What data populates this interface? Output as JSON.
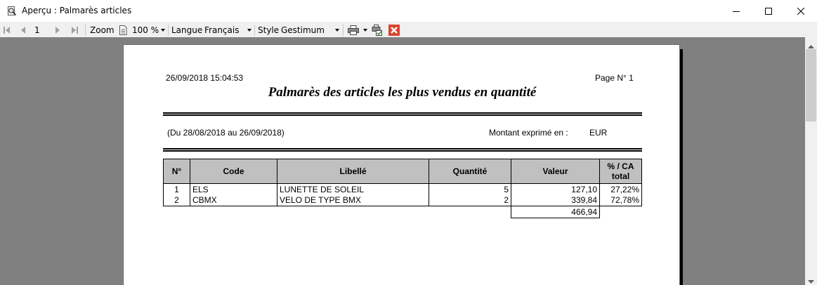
{
  "window": {
    "title": "Aperçu : Palmarès articles"
  },
  "toolbar": {
    "page_value": "1",
    "zoom_label": "Zoom",
    "zoom_value": "100 %",
    "langue_label": "Langue",
    "langue_value": "Français",
    "style_label": "Style",
    "style_value": "Gestimum"
  },
  "report": {
    "datetime": "26/09/2018 15:04:53",
    "page_number": "Page N° 1",
    "title": "Palmarès des articles les plus vendus en quantité",
    "period": "(Du 28/08/2018 au 26/09/2018)",
    "amount_label": "Montant exprimé en :",
    "currency": "EUR",
    "columns": {
      "no": "N°",
      "code": "Code",
      "libelle": "Libellé",
      "quantite": "Quantité",
      "valeur": "Valeur",
      "pct_line1": "% / CA",
      "pct_line2": "total"
    },
    "rows": [
      {
        "no": "1",
        "code": "ELS",
        "libelle": "LUNETTE DE SOLEIL",
        "quantite": "5",
        "valeur": "127,10",
        "pct": "27,22%"
      },
      {
        "no": "2",
        "code": "CBMX",
        "libelle": "VELO DE TYPE BMX",
        "quantite": "2",
        "valeur": "339,84",
        "pct": "72,78%"
      }
    ],
    "total_valeur": "466,94"
  }
}
